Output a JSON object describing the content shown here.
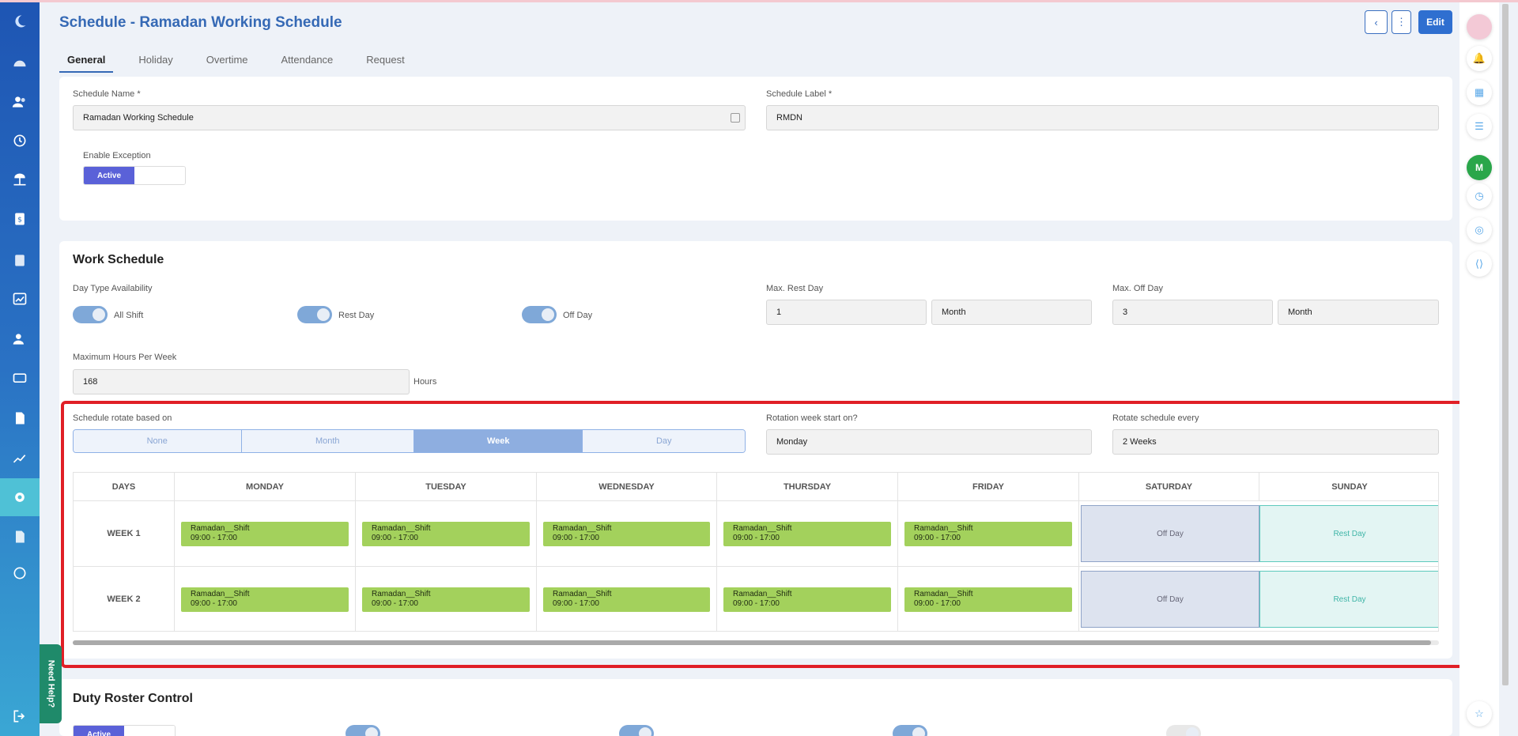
{
  "header": {
    "title": "Schedule - Ramadan Working Schedule",
    "back_icon": "chevron-left-icon",
    "more_icon": "more-vertical-icon",
    "edit_label": "Edit"
  },
  "tabs": [
    {
      "label": "General",
      "active": true
    },
    {
      "label": "Holiday",
      "active": false
    },
    {
      "label": "Overtime",
      "active": false
    },
    {
      "label": "Attendance",
      "active": false
    },
    {
      "label": "Request",
      "active": false
    }
  ],
  "general": {
    "schedule_name_label": "Schedule Name *",
    "schedule_name_value": "Ramadan Working Schedule",
    "schedule_label_label": "Schedule Label *",
    "schedule_label_value": "RMDN",
    "enable_exception_label": "Enable Exception",
    "enable_exception_state": "Active"
  },
  "work_schedule": {
    "title": "Work Schedule",
    "day_type_label": "Day Type Availability",
    "toggles": [
      {
        "label": "All Shift",
        "on": true
      },
      {
        "label": "Rest Day",
        "on": true
      },
      {
        "label": "Off Day",
        "on": true
      }
    ],
    "max_rest_day_label": "Max. Rest Day",
    "max_rest_day_value": "1",
    "max_rest_day_unit": "Month",
    "max_off_day_label": "Max. Off Day",
    "max_off_day_value": "3",
    "max_off_day_unit": "Month",
    "max_hours_label": "Maximum Hours Per Week",
    "max_hours_value": "168",
    "max_hours_unit": "Hours",
    "rotate_based_label": "Schedule rotate based on",
    "rotate_options": [
      "None",
      "Month",
      "Week",
      "Day"
    ],
    "rotate_selected": "Week",
    "rotation_start_label": "Rotation week start on?",
    "rotation_start_value": "Monday",
    "rotate_every_label": "Rotate schedule every",
    "rotate_every_value": "2 Weeks"
  },
  "schedule_table": {
    "days_header": "DAYS",
    "columns": [
      "MONDAY",
      "TUESDAY",
      "WEDNESDAY",
      "THURSDAY",
      "FRIDAY",
      "SATURDAY",
      "SUNDAY"
    ],
    "rows": [
      {
        "label": "WEEK 1",
        "shift_name": "Ramadan__Shift",
        "shift_time": "09:00 - 17:00",
        "saturday": "Off Day",
        "sunday": "Rest Day"
      },
      {
        "label": "WEEK 2",
        "shift_name": "Ramadan__Shift",
        "shift_time": "09:00 - 17:00",
        "saturday": "Off Day",
        "sunday": "Rest Day"
      }
    ]
  },
  "duty_roster": {
    "title": "Duty Roster Control",
    "state": "Active"
  },
  "need_help_label": "Need Help?",
  "colors": {
    "primary": "#3569b5",
    "shift_green": "#a3d15c",
    "highlight_red": "#e01f26",
    "toggle_on": "#7fa8d8"
  }
}
